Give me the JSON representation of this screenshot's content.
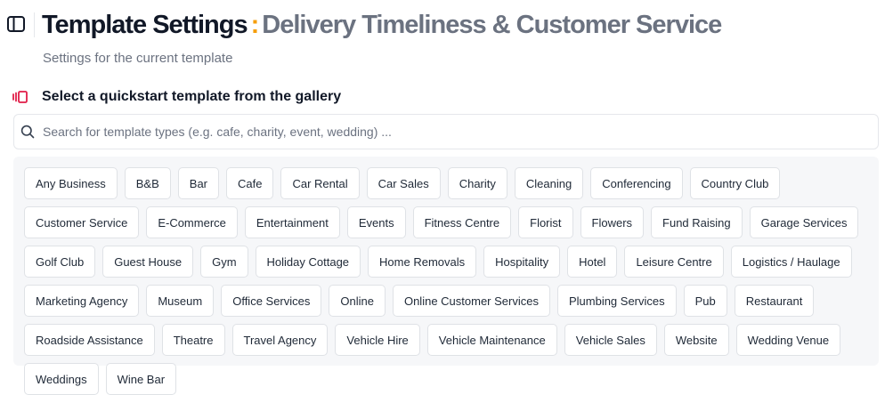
{
  "header": {
    "title": "Template Settings",
    "separator": ":",
    "template_name": "Delivery Timeliness & Customer Service",
    "subtitle": "Settings for the current template"
  },
  "icons": {
    "sidebar_toggle": "sidebar-panel-icon",
    "gallery": "gallery-icon",
    "search": "search-icon"
  },
  "colors": {
    "accent": "#f59e0b",
    "gallery_icon": "#e11d48",
    "title": "#111827",
    "title_secondary": "#6b7280"
  },
  "gallery": {
    "heading": "Select a quickstart template from the gallery",
    "search_placeholder": "Search for template types (e.g. cafe, charity, event, wedding) ...",
    "search_value": "",
    "templates": [
      "Any Business",
      "B&B",
      "Bar",
      "Cafe",
      "Car Rental",
      "Car Sales",
      "Charity",
      "Cleaning",
      "Conferencing",
      "Country Club",
      "Customer Service",
      "E-Commerce",
      "Entertainment",
      "Events",
      "Fitness Centre",
      "Florist",
      "Flowers",
      "Fund Raising",
      "Garage Services",
      "Golf Club",
      "Guest House",
      "Gym",
      "Holiday Cottage",
      "Home Removals",
      "Hospitality",
      "Hotel",
      "Leisure Centre",
      "Logistics / Haulage",
      "Marketing Agency",
      "Museum",
      "Office Services",
      "Online",
      "Online Customer Services",
      "Plumbing Services",
      "Pub",
      "Restaurant",
      "Roadside Assistance",
      "Theatre",
      "Travel Agency",
      "Vehicle Hire",
      "Vehicle Maintenance",
      "Vehicle Sales",
      "Website",
      "Wedding Venue",
      "Weddings",
      "Wine Bar"
    ]
  }
}
